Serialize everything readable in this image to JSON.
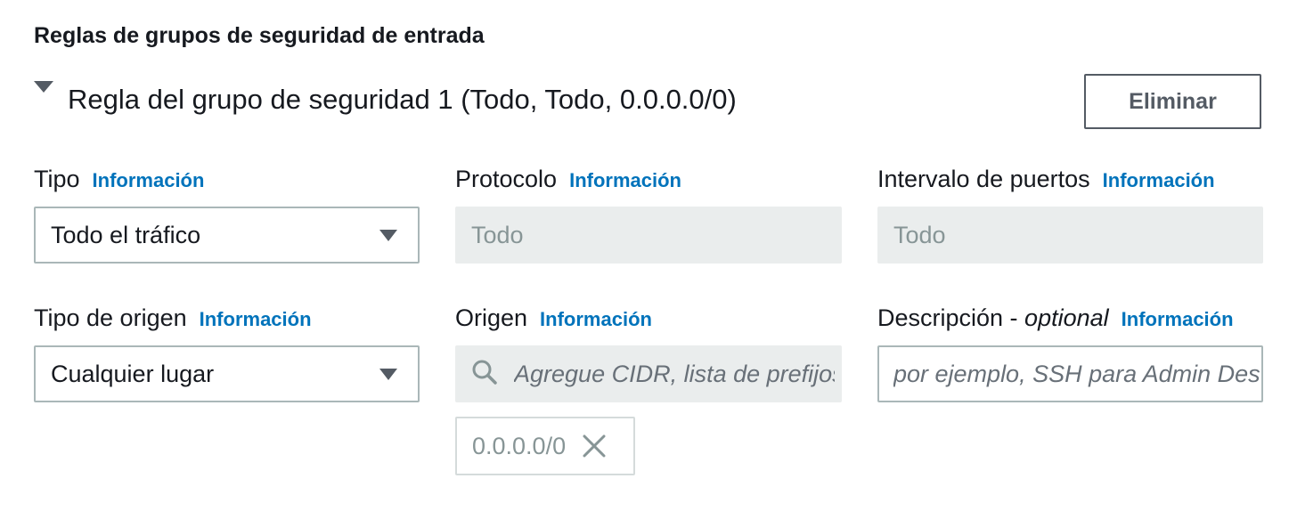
{
  "section": {
    "title": "Reglas de grupos de seguridad de entrada"
  },
  "rule": {
    "title": "Regla del grupo de seguridad 1 (Todo, Todo, 0.0.0.0/0)",
    "delete_label": "Eliminar"
  },
  "info_link": "Información",
  "fields": {
    "tipo": {
      "label": "Tipo",
      "value": "Todo el tráfico"
    },
    "protocolo": {
      "label": "Protocolo",
      "value": "Todo"
    },
    "intervalo": {
      "label": "Intervalo de puertos",
      "value": "Todo"
    },
    "tipo_origen": {
      "label": "Tipo de origen",
      "value": "Cualquier lugar"
    },
    "origen": {
      "label": "Origen",
      "placeholder": "Agregue CIDR, lista de prefijos o grupo de seguridad",
      "token": "0.0.0.0/0"
    },
    "descripcion": {
      "label": "Descripción - ",
      "optional": "optional",
      "placeholder": "por ejemplo, SSH para Admin Desktop"
    }
  },
  "icons": {
    "expand": "caret-down-icon",
    "select": "caret-down-icon",
    "search": "search-icon",
    "remove": "close-icon"
  },
  "colors": {
    "link": "#0073bb",
    "text": "#16191f",
    "disabled_bg": "#eaeded",
    "border": "#aab7b8"
  }
}
